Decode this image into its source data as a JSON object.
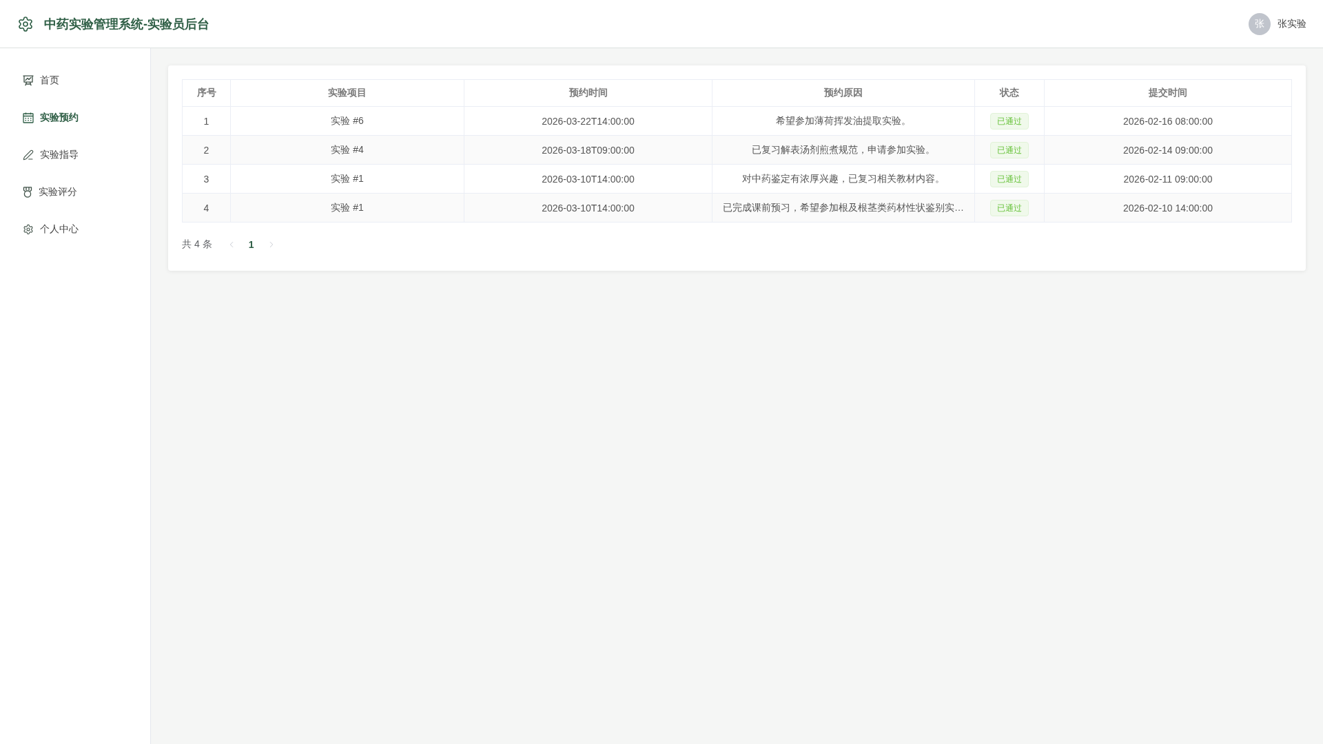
{
  "header": {
    "title": "中药实验管理系统-实验员后台",
    "user": {
      "avatar_text": "张",
      "name": "张实验"
    }
  },
  "sidebar": {
    "items": [
      {
        "label": "首页",
        "kind": "home",
        "selected": false
      },
      {
        "label": "实验预约",
        "kind": "booking",
        "selected": true
      },
      {
        "label": "实验指导",
        "kind": "guide",
        "selected": false
      },
      {
        "label": "实验评分",
        "kind": "grading",
        "selected": false
      },
      {
        "label": "个人中心",
        "kind": "profile",
        "selected": false
      }
    ]
  },
  "table": {
    "columns": [
      "序号",
      "实验项目",
      "预约时间",
      "预约原因",
      "状态",
      "提交时间"
    ],
    "rows": [
      {
        "index": "1",
        "project": "实验 #6",
        "booked_time": "2026-03-22T14:00:00",
        "reason": "希望参加薄荷挥发油提取实验。",
        "status": {
          "label": "已通过",
          "kind": "success"
        },
        "submitted_time": "2026-02-16 08:00:00"
      },
      {
        "index": "2",
        "project": "实验 #4",
        "booked_time": "2026-03-18T09:00:00",
        "reason": "已复习解表汤剂煎煮规范，申请参加实验。",
        "status": {
          "label": "已通过",
          "kind": "success"
        },
        "submitted_time": "2026-02-14 09:00:00"
      },
      {
        "index": "3",
        "project": "实验 #1",
        "booked_time": "2026-03-10T14:00:00",
        "reason": "对中药鉴定有浓厚兴趣，已复习相关教材内容。",
        "status": {
          "label": "已通过",
          "kind": "success"
        },
        "submitted_time": "2026-02-11 09:00:00"
      },
      {
        "index": "4",
        "project": "实验 #1",
        "booked_time": "2026-03-10T14:00:00",
        "reason": "已完成课前预习，希望参加根及根茎类药材性状鉴别实…",
        "status": {
          "label": "已通过",
          "kind": "success"
        },
        "submitted_time": "2026-02-10 14:00:00"
      }
    ]
  },
  "pagination": {
    "total": "共 4 条",
    "prev": {
      "disabled": true
    },
    "pages": [
      {
        "label": "1",
        "selected": true
      }
    ],
    "next": {
      "disabled": true
    }
  }
}
